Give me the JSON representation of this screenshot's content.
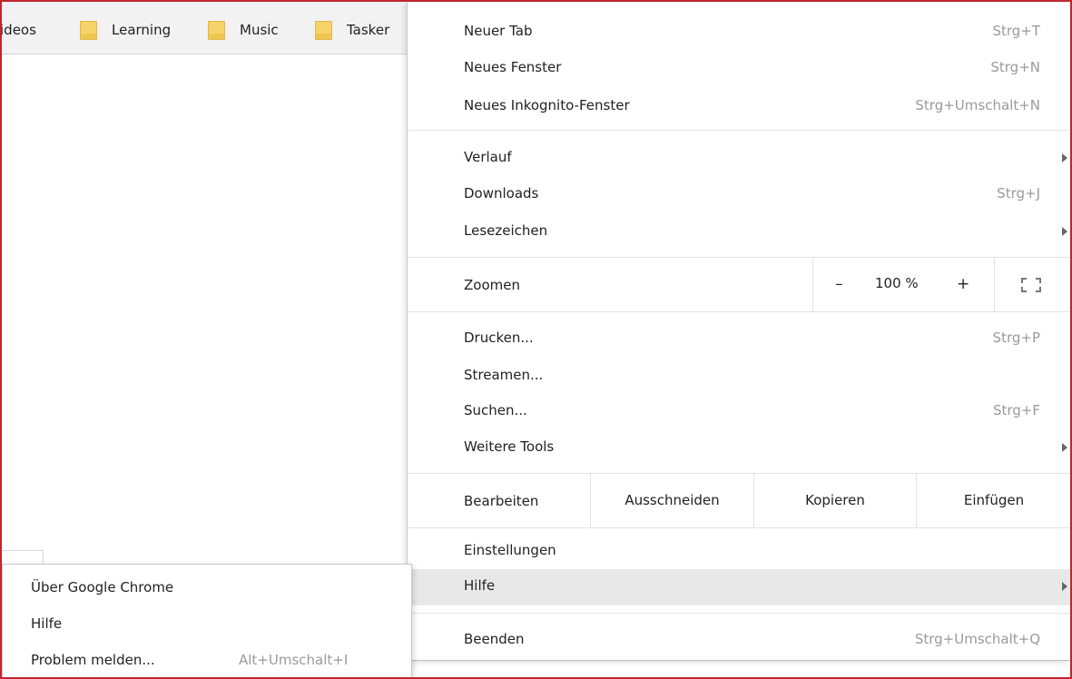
{
  "bookmarks": [
    {
      "label": "ideos",
      "folder": false
    },
    {
      "label": "Learning",
      "folder": true
    },
    {
      "label": "Music",
      "folder": true
    },
    {
      "label": "Tasker",
      "folder": true
    }
  ],
  "menu": {
    "new_tab": {
      "label": "Neuer Tab",
      "shortcut": "Strg+T"
    },
    "new_window": {
      "label": "Neues Fenster",
      "shortcut": "Strg+N"
    },
    "incognito": {
      "label": "Neues Inkognito-Fenster",
      "shortcut": "Strg+Umschalt+N"
    },
    "history": {
      "label": "Verlauf"
    },
    "downloads": {
      "label": "Downloads",
      "shortcut": "Strg+J"
    },
    "bookmarks": {
      "label": "Lesezeichen"
    },
    "zoom": {
      "label": "Zoomen",
      "minus": "–",
      "value": "100 %",
      "plus": "+"
    },
    "print": {
      "label": "Drucken...",
      "shortcut": "Strg+P"
    },
    "cast": {
      "label": "Streamen..."
    },
    "find": {
      "label": "Suchen...",
      "shortcut": "Strg+F"
    },
    "more_tools": {
      "label": "Weitere Tools"
    },
    "edit": {
      "label": "Bearbeiten",
      "cut": "Ausschneiden",
      "copy": "Kopieren",
      "paste": "Einfügen"
    },
    "settings": {
      "label": "Einstellungen"
    },
    "help": {
      "label": "Hilfe"
    },
    "exit": {
      "label": "Beenden",
      "shortcut": "Strg+Umschalt+Q"
    }
  },
  "help_submenu": [
    {
      "label": "Über Google Chrome",
      "shortcut": ""
    },
    {
      "label": "Hilfe",
      "shortcut": ""
    },
    {
      "label": "Problem melden...",
      "shortcut": "Alt+Umschalt+I"
    }
  ],
  "colors": {
    "frame": "#c0272d",
    "folder": "#f6d36a",
    "highlight": "#e8e8e8",
    "shortcut": "#9a9a9a"
  }
}
